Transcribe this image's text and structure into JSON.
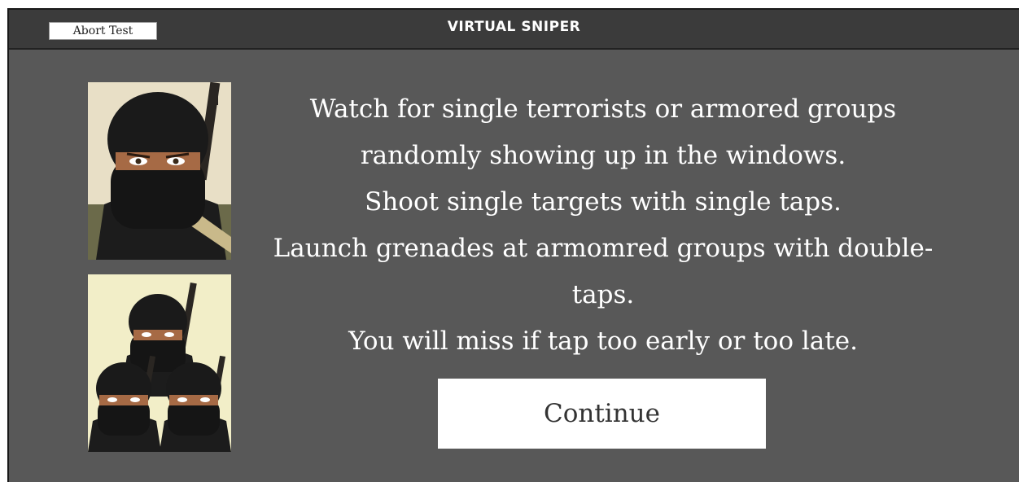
{
  "header": {
    "abort_label": "Abort Test",
    "title": "VIRTUAL SNIPER"
  },
  "instructions": {
    "line1": "Watch for single terrorists or armored groups",
    "line2": "randomly showing up in the windows.",
    "line3": "Shoot single targets with single taps.",
    "line4": "Launch grenades at armomred groups with double-",
    "line5": "taps.",
    "line6": "You will miss if tap too early or too late."
  },
  "actions": {
    "continue_label": "Continue"
  },
  "colors": {
    "background": "#585858",
    "titlebar": "#3b3b3b",
    "text": "#ffffff",
    "button": "#ffffff"
  },
  "images": {
    "single_target": "masked-terrorist-icon",
    "armored_group": "terrorist-group-icon"
  }
}
